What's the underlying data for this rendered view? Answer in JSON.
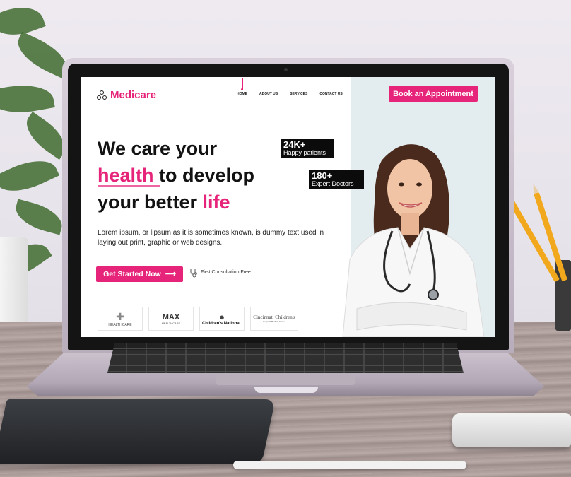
{
  "brand": {
    "name": "Medicare",
    "accent": "#e6257a"
  },
  "nav": {
    "items": [
      "HOME",
      "ABOUT US",
      "SERVICES",
      "CONTACT US"
    ],
    "active": "HOME"
  },
  "cta_book": "Book an Appointment",
  "hero": {
    "line1": "We care your",
    "line2_highlight": "health",
    "line2_rest": " to develop",
    "line3_text": "your better ",
    "line3_highlight": "life",
    "description": "Lorem ipsum, or lipsum as it is sometimes known, is dummy text used in laying out print, graphic or web designs."
  },
  "cta_start": "Get Started Now",
  "consultation": "First Consultation Free",
  "stats": [
    {
      "value": "24K+",
      "label": "Happy patients"
    },
    {
      "value": "180+",
      "label": "Expert Doctors"
    }
  ],
  "partners": [
    {
      "name": "HEALTHCARE"
    },
    {
      "name": "MAX",
      "sub": "HEALTHCARE"
    },
    {
      "name": "Children's National."
    },
    {
      "name": "Cincinnati Children's",
      "sub": "Hospital Medical Center"
    }
  ]
}
